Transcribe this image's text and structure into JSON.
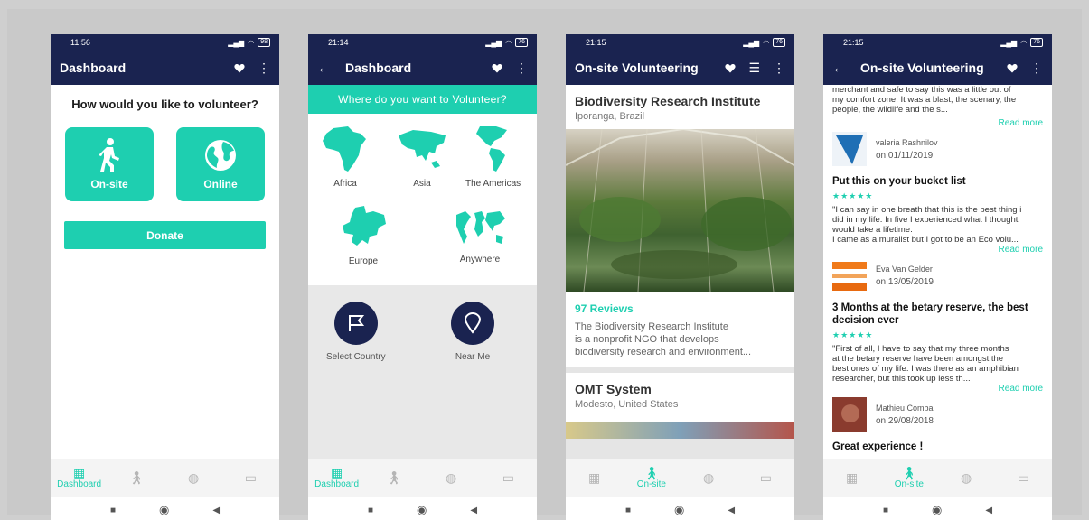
{
  "colors": {
    "navy": "#1a2350",
    "teal": "#1ecfb0"
  },
  "nav": {
    "dashboard": "Dashboard",
    "onsite": "On-site"
  },
  "phone1": {
    "time": "11:56",
    "battery": "98",
    "title": "Dashboard",
    "question": "How would you like to volunteer?",
    "onsite_label": "On-site",
    "online_label": "Online",
    "donate_label": "Donate"
  },
  "phone2": {
    "time": "21:14",
    "battery": "76",
    "title": "Dashboard",
    "banner": "Where do you want to Volunteer?",
    "regions": {
      "africa": "Africa",
      "asia": "Asia",
      "americas": "The Americas",
      "europe": "Europe",
      "anywhere": "Anywhere"
    },
    "select_country": "Select Country",
    "near_me": "Near Me"
  },
  "phone3": {
    "time": "21:15",
    "battery": "76",
    "title": "On-site Volunteering",
    "card1": {
      "title": "Biodiversity Research Institute",
      "location": "Iporanga, Brazil",
      "reviews": "97 Reviews",
      "desc_line1": "The Biodiversity Research Institute",
      "desc_line2": "is a nonprofit NGO that develops",
      "desc_line3": "biodiversity research and environment..."
    },
    "card2": {
      "title": "OMT System",
      "location": "Modesto, United States"
    }
  },
  "phone4": {
    "time": "21:15",
    "battery": "76",
    "title": "On-site Volunteering",
    "top_text_1": "merchant and safe to say this was a little out of",
    "top_text_2": "my comfort zone. It was a blast, the scenary, the",
    "top_text_3": "people, the wildlife and the s...",
    "read_more": "Read more",
    "r1_name": "valeria Rashnilov",
    "r1_date": "on 01/11/2019",
    "rev2_title": "Put this on your bucket list",
    "stars": "★★★★★",
    "rev2_l1": "\"I can say in one breath that this is the best thing i",
    "rev2_l2": "did in my life. In five I experienced what I thought",
    "rev2_l3": "would take a lifetime.",
    "rev2_l4": "I came as a muralist but I got to be an Eco volu...",
    "r2_name": "Eva Van Gelder",
    "r2_date": "on 13/05/2019",
    "rev3_title_1": "3 Months at the betary reserve, the best",
    "rev3_title_2": "decision ever",
    "rev3_l1": "\"First of all, I have to say that my three months",
    "rev3_l2": "at the betary reserve have been amongst the",
    "rev3_l3": "best ones of my life. I was there as an amphibian",
    "rev3_l4": "researcher, but this took up less th...",
    "r3_name": "Mathieu Comba",
    "r3_date": "on 29/08/2018",
    "rev4_title": "Great experience !"
  }
}
